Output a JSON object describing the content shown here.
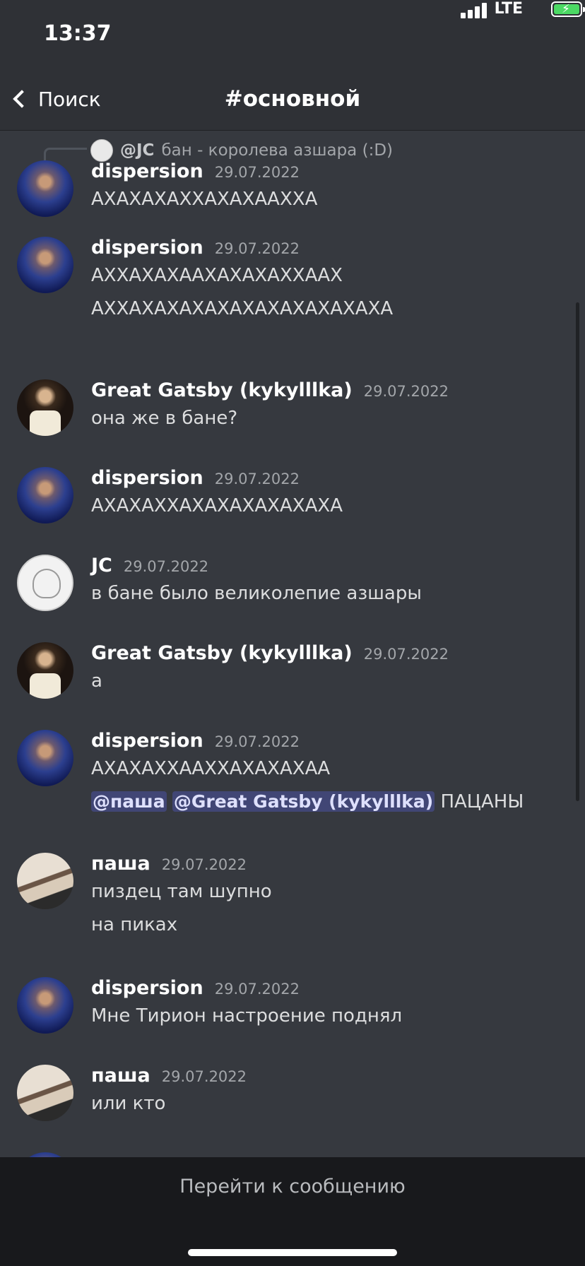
{
  "status": {
    "time": "13:37",
    "network": "LTE"
  },
  "nav": {
    "back_label": "Поиск",
    "title": "#основной"
  },
  "reply": {
    "author": "@JC",
    "text": "бан - королева азшара (:D)"
  },
  "messages": [
    {
      "author": "dispersion",
      "time": "29.07.2022",
      "avatar": "dispersion",
      "lines": [
        "АХАХАХАХХАХАХААХХА"
      ]
    },
    {
      "author": "dispersion",
      "time": "29.07.2022",
      "avatar": "dispersion",
      "lines": [
        "АХХАХАХААХАХАХАХХААХ",
        "АХХАХАХАХАХАХАХАХАХАХАХА"
      ]
    },
    {
      "author": "Great Gatsby (kykylllka)",
      "time": "29.07.2022",
      "avatar": "gatsby",
      "lines": [
        "она же в бане?"
      ]
    },
    {
      "author": "dispersion",
      "time": "29.07.2022",
      "avatar": "dispersion",
      "lines": [
        "АХАХАХХАХАХАХАХАХАХА"
      ]
    },
    {
      "author": "JC",
      "time": "29.07.2022",
      "avatar": "jc",
      "lines": [
        "в бане было великолепие азшары"
      ]
    },
    {
      "author": "Great Gatsby (kykylllka)",
      "time": "29.07.2022",
      "avatar": "gatsby",
      "lines": [
        "а"
      ]
    },
    {
      "author": "dispersion",
      "time": "29.07.2022",
      "avatar": "dispersion",
      "lines": [
        "АХАХАХХААХХАХАХАХАА"
      ],
      "mention_line": {
        "m1": "@паша",
        "m2": "@Great Gatsby (kykylllka)",
        "text": "ПАЦАНЫ"
      }
    },
    {
      "author": "паша",
      "time": "29.07.2022",
      "avatar": "pasha",
      "lines": [
        "пиздец там шупно",
        "на пиках"
      ]
    },
    {
      "author": "dispersion",
      "time": "29.07.2022",
      "avatar": "dispersion",
      "lines": [
        "Мне Тирион настроение поднял"
      ]
    },
    {
      "author": "паша",
      "time": "29.07.2022",
      "avatar": "pasha",
      "lines": [
        "или кто"
      ]
    }
  ],
  "footer": {
    "jump_label": "Перейти к сообщению"
  }
}
